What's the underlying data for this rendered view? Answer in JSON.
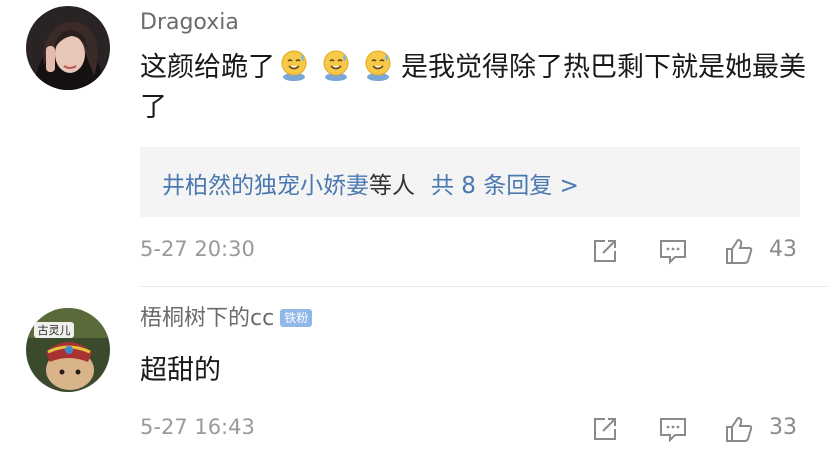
{
  "comments": [
    {
      "username": "Dragoxia",
      "text_before": "这颜给跪了",
      "emoji_icons": [
        "sweat-smile-emoji-icon",
        "sweat-smile-emoji-icon",
        "sweat-smile-emoji-icon"
      ],
      "text_after": "是我觉得除了热巴剩下就是她最美了",
      "reply_summary": {
        "names": "井柏然的独宠小娇妻",
        "middle": "等人",
        "count_link": "共 8 条回复 >"
      },
      "timestamp": "5-27 20:30",
      "likes": "43"
    },
    {
      "username": "梧桐树下的cc",
      "badge": "铁粉",
      "avatar_caption": "古灵儿",
      "text": "超甜的",
      "timestamp": "5-27 16:43",
      "likes": "33"
    }
  ],
  "icons": {
    "share": "share-icon",
    "comment": "comment-icon",
    "like": "thumbs-up-icon"
  },
  "colors": {
    "link_blue": "#4a78b0",
    "meta_gray": "#9a9a9a",
    "reply_bg": "#f4f4f4",
    "badge_blue": "#8fb7e8"
  }
}
